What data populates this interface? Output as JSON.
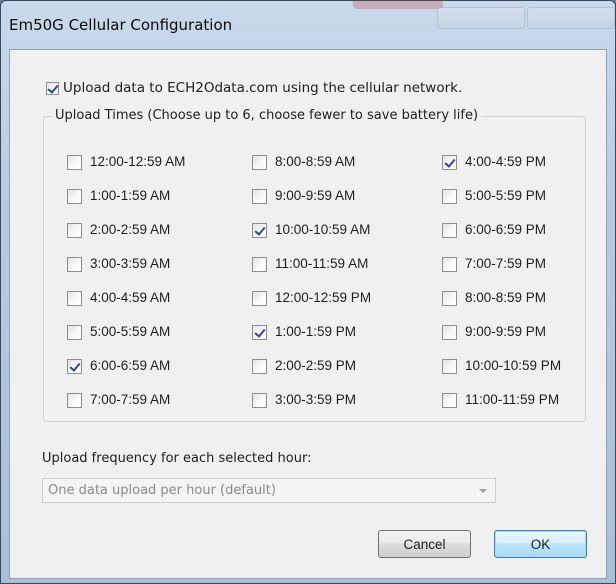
{
  "window": {
    "title": "Em50G Cellular Configuration"
  },
  "upload_enabled": {
    "label": "Upload data to ECH2Odata.com using the cellular network.",
    "checked": true
  },
  "upload_times": {
    "legend": "Upload Times (Choose up to 6, choose fewer to save battery life)",
    "columns": [
      [
        {
          "label": "12:00-12:59 AM",
          "checked": false
        },
        {
          "label": "1:00-1:59 AM",
          "checked": false
        },
        {
          "label": "2:00-2:59 AM",
          "checked": false
        },
        {
          "label": "3:00-3:59 AM",
          "checked": false
        },
        {
          "label": "4:00-4:59 AM",
          "checked": false
        },
        {
          "label": "5:00-5:59 AM",
          "checked": false
        },
        {
          "label": "6:00-6:59 AM",
          "checked": true
        },
        {
          "label": "7:00-7:59 AM",
          "checked": false
        }
      ],
      [
        {
          "label": "8:00-8:59 AM",
          "checked": false
        },
        {
          "label": "9:00-9:59 AM",
          "checked": false
        },
        {
          "label": "10:00-10:59 AM",
          "checked": true
        },
        {
          "label": "11:00-11:59 AM",
          "checked": false
        },
        {
          "label": "12:00-12:59 PM",
          "checked": false
        },
        {
          "label": "1:00-1:59 PM",
          "checked": true
        },
        {
          "label": "2:00-2:59 PM",
          "checked": false
        },
        {
          "label": "3:00-3:59 PM",
          "checked": false
        }
      ],
      [
        {
          "label": "4:00-4:59 PM",
          "checked": true
        },
        {
          "label": "5:00-5:59 PM",
          "checked": false
        },
        {
          "label": "6:00-6:59 PM",
          "checked": false
        },
        {
          "label": "7:00-7:59 PM",
          "checked": false
        },
        {
          "label": "8:00-8:59 PM",
          "checked": false
        },
        {
          "label": "9:00-9:59 PM",
          "checked": false
        },
        {
          "label": "10:00-10:59 PM",
          "checked": false
        },
        {
          "label": "11:00-11:59 PM",
          "checked": false
        }
      ]
    ]
  },
  "frequency": {
    "label": "Upload frequency for each selected hour:",
    "selected": "One data upload per hour (default)",
    "disabled": true
  },
  "buttons": {
    "cancel": "Cancel",
    "ok": "OK"
  }
}
